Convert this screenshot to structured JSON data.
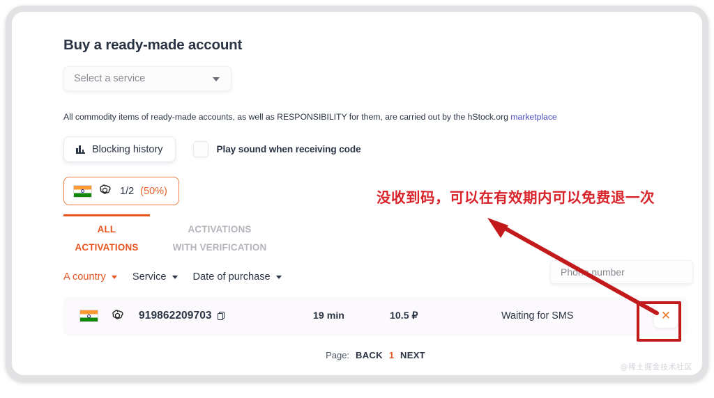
{
  "page": {
    "title": "Buy a ready-made account"
  },
  "service_select": {
    "placeholder": "Select a service",
    "caret_icon": "chevron-down-icon"
  },
  "disclaimer": {
    "text": "All commodity items of ready-made accounts, as well as RESPONSIBILITY for them, are carried out by the hStock.org ",
    "link_text": "marketplace",
    "link_color": "#4b4fbd"
  },
  "tools": {
    "blocking_history_label": "Blocking history",
    "blocking_history_icon": "bar-chart-icon",
    "sound_checkbox_label": "Play sound when receiving code",
    "sound_checkbox_checked": false
  },
  "service_chip": {
    "flag": "india-flag-icon",
    "service_icon": "openai-logo-icon",
    "counter": "1/2",
    "percent": "(50%)",
    "accent_color": "#e8622b"
  },
  "tabs": [
    {
      "label": "ALL\nACTIVATIONS",
      "active": true
    },
    {
      "label": "ACTIVATIONS\nWITH VERIFICATION",
      "active": false
    }
  ],
  "filters": [
    {
      "label": "A country",
      "active": true
    },
    {
      "label": "Service",
      "active": false
    },
    {
      "label": "Date of purchase",
      "active": false
    }
  ],
  "phone_search": {
    "placeholder": "Phone number",
    "value": ""
  },
  "activations": {
    "rows": [
      {
        "flag": "india-flag-icon",
        "service_icon": "openai-logo-icon",
        "number": "919862209703",
        "copy_icon": "copy-icon",
        "time": "19 min",
        "price": "10.5 ₽",
        "status": "Waiting for SMS",
        "cancel_icon": "close-icon",
        "cancel_label": "✕"
      }
    ]
  },
  "pagination": {
    "label": "Page:",
    "back": "BACK",
    "current": "1",
    "next": "NEXT",
    "current_color": "#e8541f"
  },
  "annotations": {
    "text": "没收到码，可以在有效期内可以免费退一次",
    "color": "#d8232a",
    "arrow": "red-arrow-annotation",
    "highlight_box": "red-rectangle-annotation"
  },
  "watermark": {
    "text": "@稀土掘金技术社区"
  }
}
